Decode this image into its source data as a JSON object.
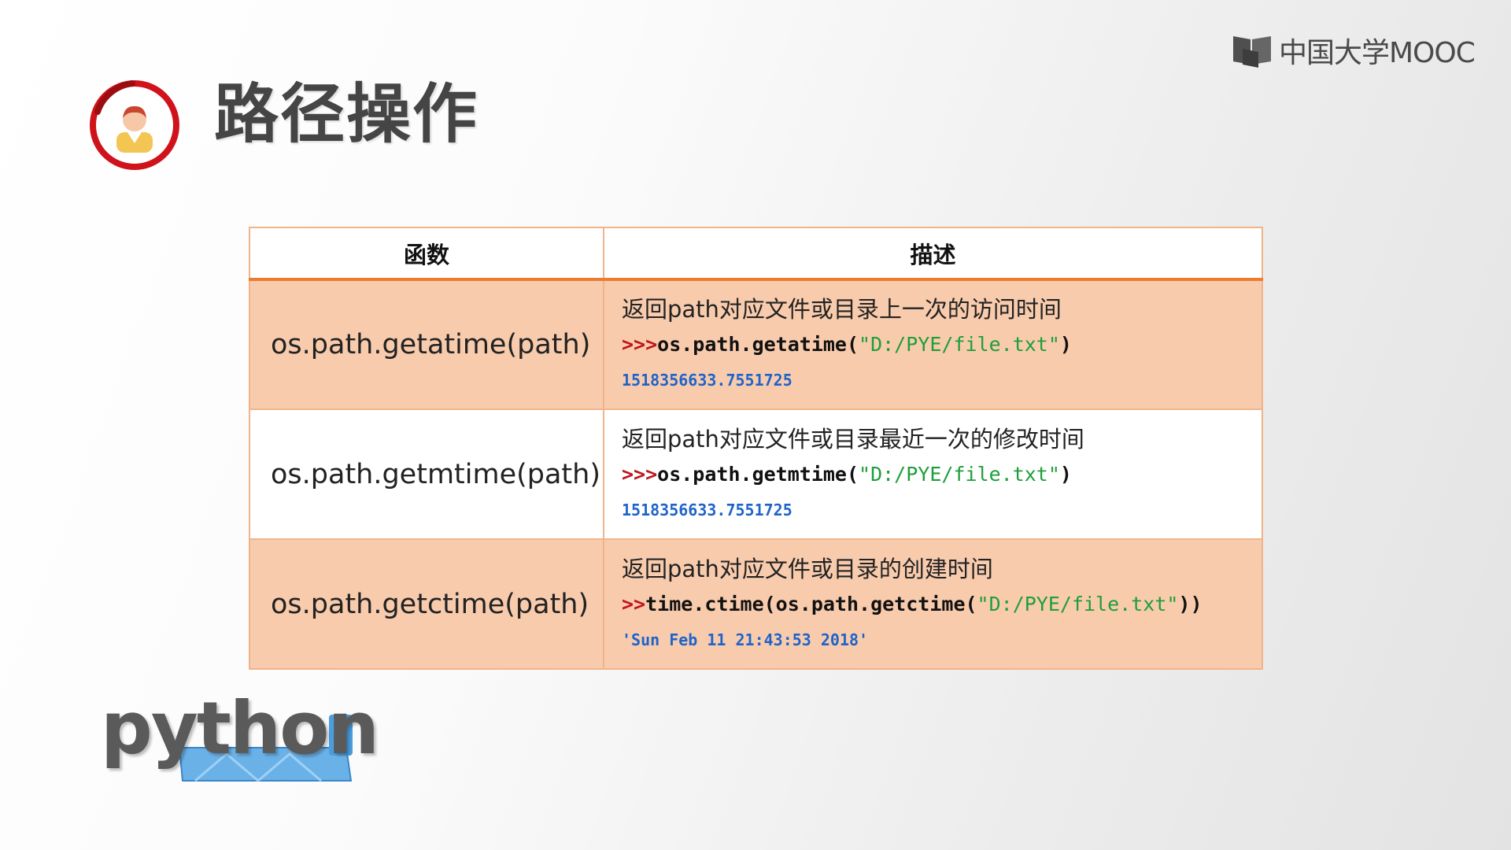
{
  "brand": {
    "logo_text": "中国大学MOOC",
    "logo_icon": "book-icon"
  },
  "title": {
    "text": "路径操作",
    "icon": "user-avatar-icon"
  },
  "table": {
    "headers": [
      "函数",
      "描述"
    ],
    "rows": [
      {
        "function": "os.path.getatime(path)",
        "description": "返回path对应文件或目录上一次的访问时间",
        "prompt": ">>>",
        "code": "os.path.getatime(",
        "string": "\"D:/PYE/file.txt\"",
        "code_end": ")",
        "output": "1518356633.7551725"
      },
      {
        "function": "os.path.getmtime(path)",
        "description": "返回path对应文件或目录最近一次的修改时间",
        "prompt": ">>>",
        "code": "os.path.getmtime(",
        "string": "\"D:/PYE/file.txt\"",
        "code_end": ")",
        "output": "1518356633.7551725"
      },
      {
        "function": "os.path.getctime(path)",
        "description": "返回path对应文件或目录的创建时间",
        "prompt": ">>",
        "code": "time.ctime(os.path.getctime(",
        "string": "\"D:/PYE/file.txt\"",
        "code_end": "))",
        "output": "'Sun Feb 11 21:43:53 2018'"
      }
    ]
  },
  "footer": {
    "python_logo_text": "python"
  },
  "colors": {
    "accent_orange": "#ec7c30",
    "row_fill": "#f8cbad",
    "prompt_red": "#c0141e",
    "string_green": "#1e9e3a",
    "output_blue": "#1f63c9",
    "avatar_ring": "#d0121b"
  }
}
